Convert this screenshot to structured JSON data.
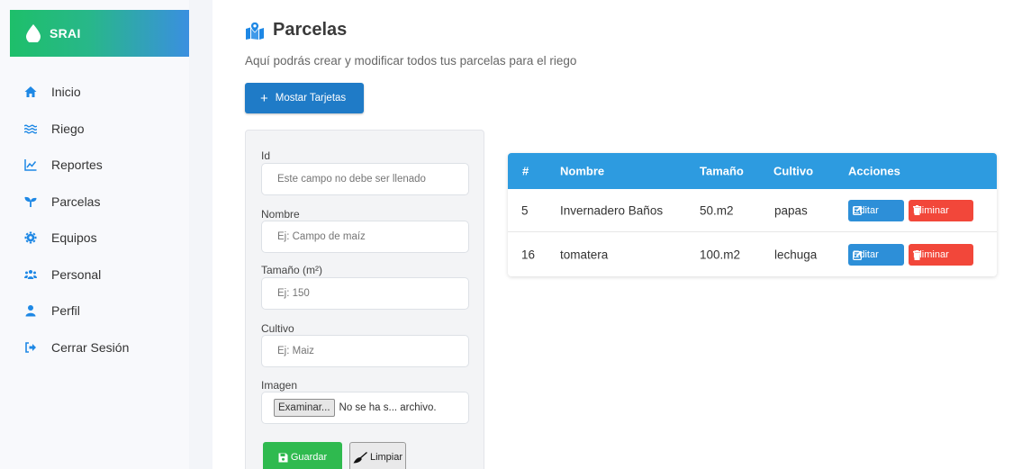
{
  "brand": {
    "name": "SRAI",
    "icon": "droplet-icon"
  },
  "sidebar": {
    "items": [
      {
        "label": "Inicio",
        "icon": "home-icon"
      },
      {
        "label": "Riego",
        "icon": "water-waves-icon"
      },
      {
        "label": "Reportes",
        "icon": "chart-line-icon"
      },
      {
        "label": "Parcelas",
        "icon": "seedling-icon"
      },
      {
        "label": "Equipos",
        "icon": "gear-icon"
      },
      {
        "label": "Personal",
        "icon": "users-icon"
      },
      {
        "label": "Perfil",
        "icon": "user-icon"
      },
      {
        "label": "Cerrar Sesión",
        "icon": "sign-out-icon"
      }
    ]
  },
  "header": {
    "title": "Parcelas",
    "title_icon": "map-marked-icon",
    "subtitle": "Aquí podrás crear y modificar todos tus parcelas para el riego"
  },
  "toolbar": {
    "show_cards_label": "Mostar Tarjetas"
  },
  "form": {
    "id_label": "Id",
    "id_placeholder": "Este campo no debe ser llenado",
    "name_label": "Nombre",
    "name_placeholder": "Ej: Campo de maíz",
    "size_label": "Tamaño (m²)",
    "size_placeholder": "Ej: 150",
    "crop_label": "Cultivo",
    "crop_placeholder": "Ej: Maiz",
    "image_label": "Imagen",
    "file_button": "Examinar...",
    "file_status": "No se ha s... archivo.",
    "save_label": "Guardar",
    "clear_label": "Limpiar"
  },
  "table": {
    "headers": [
      "#",
      "Nombre",
      "Tamaño",
      "Cultivo",
      "Acciones"
    ],
    "rows": [
      {
        "id": "5",
        "name": "Invernadero Baños",
        "size": "50.m2",
        "crop": "papas"
      },
      {
        "id": "16",
        "name": "tomatera",
        "size": "100.m2",
        "crop": "lechuga"
      }
    ],
    "edit_label": "Editar",
    "delete_label": "Eliminar"
  },
  "colors": {
    "primary": "#1f7bc7",
    "table_header": "#2d9be0",
    "success": "#2fba4f",
    "danger": "#f2473a",
    "accent": "#1e88e5"
  }
}
